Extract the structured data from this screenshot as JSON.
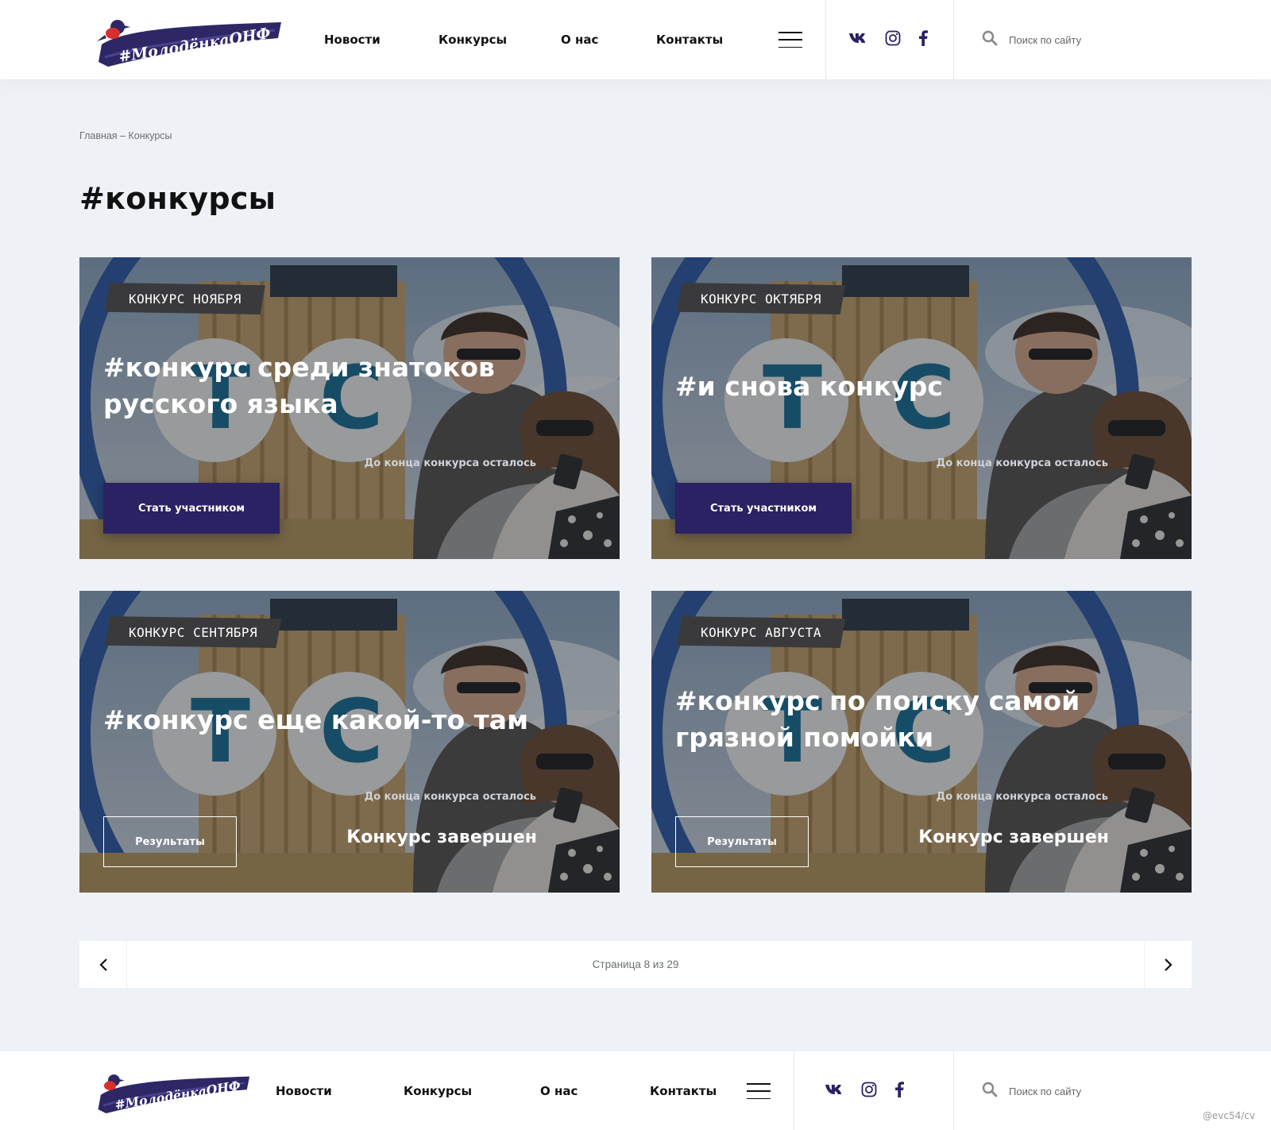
{
  "header": {
    "logo_text": "#МолодёнкаОНФ",
    "nav": [
      "Новости",
      "Конкурсы",
      "О нас",
      "Контакты"
    ],
    "search_placeholder": "Поиск по сайту",
    "social_icons": [
      "vk-icon",
      "instagram-icon",
      "facebook-icon"
    ]
  },
  "breadcrumb": "Главная – Конкурсы",
  "page_title": "#конкурсы",
  "cards": [
    {
      "tag": "Конкурс ноября",
      "title": "#конкурс среди знатоков русского языка",
      "remaining_label": "До конца конкурса осталось",
      "button": "Стать участником",
      "status": ""
    },
    {
      "tag": "Конкурс октября",
      "title": "#и снова конкурс",
      "remaining_label": "До конца конкурса осталось",
      "button": "Стать участником",
      "status": ""
    },
    {
      "tag": "Конкурс сентября",
      "title": "#конкурс еще какой-то там",
      "remaining_label": "До конца конкурса осталось",
      "button": "Результаты",
      "status": "Конкурс завершен"
    },
    {
      "tag": "Конкурс августа",
      "title": "#конкурс по поиску самой грязной помойки",
      "remaining_label": "До конца конкурса осталось",
      "button": "Результаты",
      "status": "Конкурс завершен"
    }
  ],
  "pagination": {
    "label": "Страница 8 из 29",
    "current": 8,
    "total": 29
  },
  "footer": {
    "logo_text": "#МолодёнкаОНФ",
    "nav": [
      "Новости",
      "Конкурсы",
      "О нас",
      "Контакты"
    ],
    "search_placeholder": "Поиск по сайту"
  },
  "watermark": "@evc54/cv",
  "colors": {
    "brand_dark": "#2a2262",
    "page_bg": "#eef1f5",
    "logo_brush": "#2e2766",
    "bird_red": "#d9302b"
  }
}
